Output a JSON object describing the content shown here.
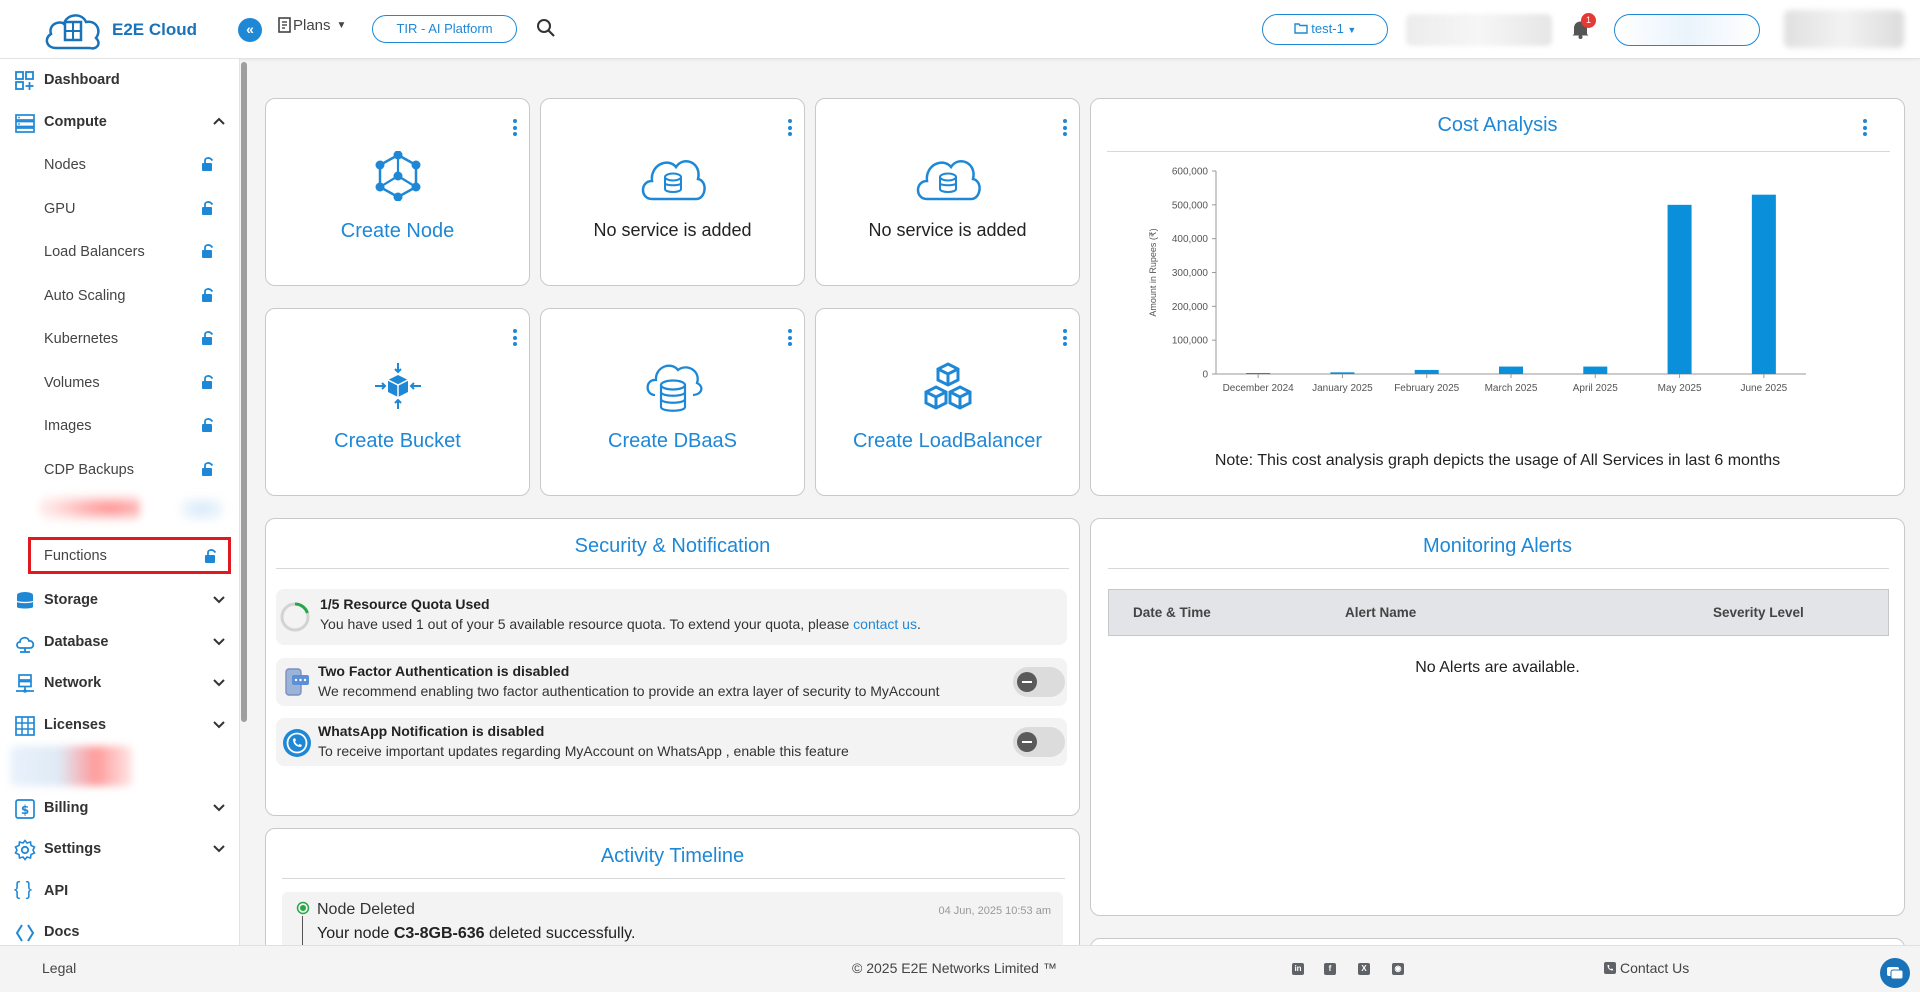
{
  "header": {
    "logo_text": "E2E Cloud",
    "plans_label": "Plans",
    "platform_button": "TIR - AI Platform",
    "project_selector": "test-1",
    "notification_count": "1"
  },
  "sidebar": {
    "dashboard": "Dashboard",
    "compute": "Compute",
    "compute_items": [
      "Nodes",
      "GPU",
      "Load Balancers",
      "Auto Scaling",
      "Kubernetes",
      "Volumes",
      "Images",
      "CDP Backups",
      "Functions"
    ],
    "groups": [
      "Storage",
      "Database",
      "Network",
      "Licenses",
      "Billing",
      "Settings"
    ],
    "api": "API",
    "docs": "Docs"
  },
  "tiles": {
    "create_node": "Create Node",
    "no_service_1": "No service is added",
    "no_service_2": "No service is added",
    "create_bucket": "Create Bucket",
    "create_dbaas": "Create DBaaS",
    "create_lb": "Create LoadBalancer"
  },
  "cost": {
    "title": "Cost Analysis",
    "note": "Note: This cost analysis graph depicts the usage of All Services in last 6 months"
  },
  "chart_data": {
    "type": "bar",
    "title": "",
    "xlabel": "",
    "ylabel": "Amount in Rupees (₹)",
    "categories": [
      "December 2024",
      "January 2025",
      "February 2025",
      "March 2025",
      "April 2025",
      "May 2025",
      "June 2025"
    ],
    "values": [
      3000,
      5000,
      12000,
      22000,
      22000,
      500000,
      530000
    ],
    "ylim": [
      0,
      600000
    ],
    "yticks": [
      "0",
      "100,000",
      "200,000",
      "300,000",
      "400,000",
      "500,000",
      "600,000"
    ],
    "color": "#0a8fda",
    "grid": false
  },
  "security": {
    "title": "Security & Notification",
    "quota_title": "1/5 Resource Quota Used",
    "quota_text": "You have used 1 out of your 5 available resource quota. To extend your quota, please ",
    "quota_link": "contact us",
    "quota_end": ".",
    "twofa_title": "Two Factor Authentication is disabled",
    "twofa_text": "We recommend enabling two factor authentication to provide an extra layer of security to MyAccount",
    "whatsapp_title": "WhatsApp Notification is disabled",
    "whatsapp_text": "To receive important updates regarding MyAccount on WhatsApp , enable this feature"
  },
  "alerts": {
    "title": "Monitoring Alerts",
    "col_date": "Date & Time",
    "col_name": "Alert Name",
    "col_severity": "Severity Level",
    "empty": "No Alerts are available."
  },
  "activity": {
    "title": "Activity Timeline",
    "event": "Node Deleted",
    "timestamp": "04 Jun, 2025 10:53 am",
    "text_pre": "Your node ",
    "node": "C3-8GB-636",
    "text_post": " deleted successfully."
  },
  "footer": {
    "legal": "Legal",
    "copyright": "© 2025 E2E Networks Limited ™",
    "contact": "Contact Us"
  },
  "colors": {
    "accent": "#1e88d6",
    "highlight": "#e0191e"
  }
}
